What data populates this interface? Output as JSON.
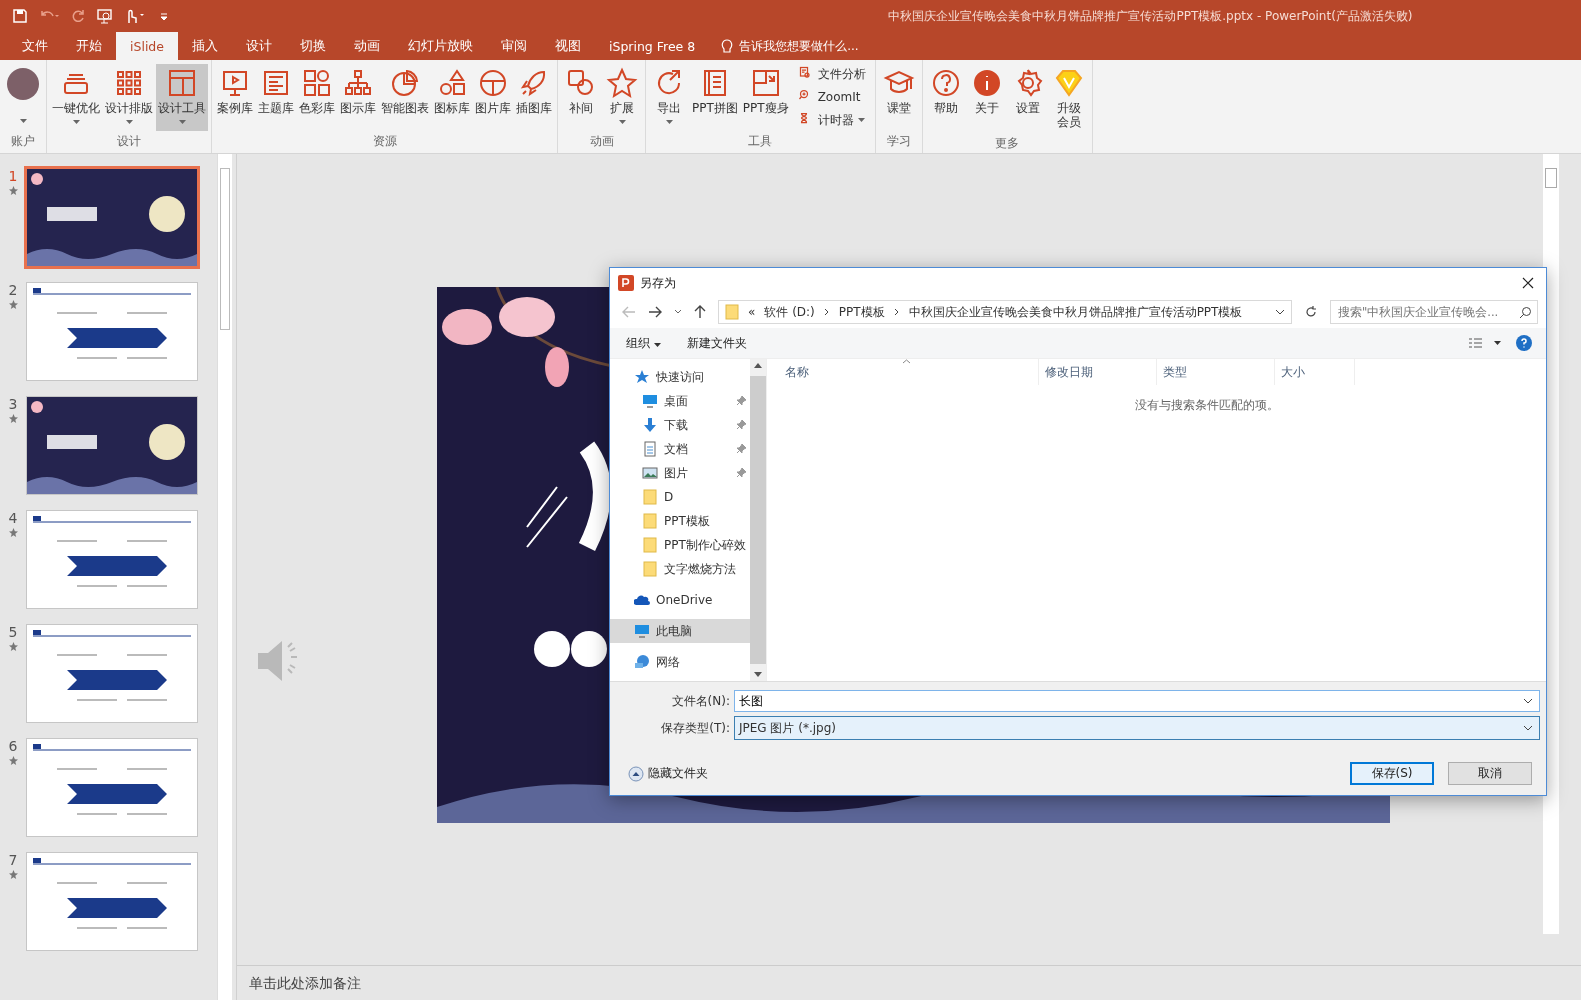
{
  "window": {
    "title": "中秋国庆企业宣传晚会美食中秋月饼品牌推广宣传活动PPT模板.pptx - PowerPoint(产品激活失败)"
  },
  "tabs": [
    {
      "label": "文件",
      "selected": false
    },
    {
      "label": "开始",
      "selected": false
    },
    {
      "label": "iSlide",
      "selected": true
    },
    {
      "label": "插入",
      "selected": false
    },
    {
      "label": "设计",
      "selected": false
    },
    {
      "label": "切换",
      "selected": false
    },
    {
      "label": "动画",
      "selected": false
    },
    {
      "label": "幻灯片放映",
      "selected": false
    },
    {
      "label": "审阅",
      "selected": false
    },
    {
      "label": "视图",
      "selected": false
    },
    {
      "label": "iSpring Free 8",
      "selected": false
    }
  ],
  "tell_me": {
    "placeholder": "告诉我您想要做什么..."
  },
  "ribbon": {
    "groups": [
      {
        "label": "账户",
        "items": [
          {
            "kind": "avatar",
            "dropdown": true
          }
        ]
      },
      {
        "label": "设计",
        "items": [
          {
            "kind": "large",
            "label": "一键优化",
            "dropdown": true,
            "selected": false
          },
          {
            "kind": "large",
            "label": "设计排版",
            "dropdown": true,
            "selected": false
          },
          {
            "kind": "large",
            "label": "设计工具",
            "dropdown": true,
            "selected": true
          }
        ]
      },
      {
        "label": "资源",
        "items": [
          {
            "kind": "large",
            "label": "案例库",
            "dropdown": false,
            "selected": false
          },
          {
            "kind": "large",
            "label": "主题库",
            "dropdown": false,
            "selected": false
          },
          {
            "kind": "large",
            "label": "色彩库",
            "dropdown": false,
            "selected": false
          },
          {
            "kind": "large",
            "label": "图示库",
            "dropdown": false,
            "selected": false
          },
          {
            "kind": "large",
            "label": "智能图表",
            "dropdown": false,
            "selected": false
          },
          {
            "kind": "large",
            "label": "图标库",
            "dropdown": false,
            "selected": false
          },
          {
            "kind": "large",
            "label": "图片库",
            "dropdown": false,
            "selected": false
          },
          {
            "kind": "large",
            "label": "插图库",
            "dropdown": false,
            "selected": false
          }
        ]
      },
      {
        "label": "动画",
        "items": [
          {
            "kind": "large",
            "label": "补间",
            "dropdown": false,
            "selected": false
          },
          {
            "kind": "large",
            "label": "扩展",
            "dropdown": true,
            "selected": false
          }
        ]
      },
      {
        "label": "工具",
        "items": [
          {
            "kind": "large",
            "label": "导出",
            "dropdown": true,
            "selected": false
          },
          {
            "kind": "large",
            "label": "PPT拼图",
            "dropdown": false,
            "selected": false
          },
          {
            "kind": "large",
            "label": "PPT瘦身",
            "dropdown": false,
            "selected": false
          },
          {
            "kind": "small",
            "label": "文件分析",
            "dropdown": false,
            "selected": false
          },
          {
            "kind": "small",
            "label": "ZoomIt",
            "dropdown": false,
            "selected": false
          },
          {
            "kind": "small",
            "label": "计时器",
            "dropdown": true,
            "selected": false
          }
        ]
      },
      {
        "label": "学习",
        "items": [
          {
            "kind": "large",
            "label": "课堂",
            "dropdown": false,
            "selected": false
          }
        ]
      },
      {
        "label": "更多",
        "items": [
          {
            "kind": "large",
            "label": "帮助",
            "dropdown": false,
            "selected": false
          },
          {
            "kind": "large",
            "label": "关于",
            "dropdown": false,
            "selected": false
          },
          {
            "kind": "large",
            "label": "设置",
            "dropdown": false,
            "selected": false
          },
          {
            "kind": "tall",
            "label": "升级会员",
            "dropdown": false,
            "selected": false
          }
        ]
      }
    ]
  },
  "slides": [
    {
      "number": "1",
      "selected": true,
      "kind": "dark"
    },
    {
      "number": "2",
      "selected": false,
      "kind": "light"
    },
    {
      "number": "3",
      "selected": false,
      "kind": "dark"
    },
    {
      "number": "4",
      "selected": false,
      "kind": "light"
    },
    {
      "number": "5",
      "selected": false,
      "kind": "light"
    },
    {
      "number": "6",
      "selected": false,
      "kind": "light"
    },
    {
      "number": "7",
      "selected": false,
      "kind": "light"
    }
  ],
  "notes": {
    "placeholder": "单击此处添加备注"
  },
  "dialog": {
    "title": "另存为",
    "address": {
      "prefix": "«",
      "crumbs": [
        "软件 (D:)",
        "PPT模板",
        "中秋国庆企业宣传晚会美食中秋月饼品牌推广宣传活动PPT模板"
      ]
    },
    "search": {
      "placeholder": "搜索\"中秋国庆企业宣传晚会..."
    },
    "toolbar": {
      "organize": "组织",
      "new_folder": "新建文件夹"
    },
    "nav": [
      {
        "label": "快速访问",
        "kind": "quick",
        "pinned": false,
        "selected": false,
        "children": [
          {
            "label": "桌面",
            "kind": "desktop",
            "pinned": true,
            "selected": false
          },
          {
            "label": "下载",
            "kind": "download",
            "pinned": true,
            "selected": false
          },
          {
            "label": "文档",
            "kind": "docs",
            "pinned": true,
            "selected": false
          },
          {
            "label": "图片",
            "kind": "pictures",
            "pinned": true,
            "selected": false
          },
          {
            "label": "D",
            "kind": "folder",
            "pinned": false,
            "selected": false
          },
          {
            "label": "PPT模板",
            "kind": "folder",
            "pinned": false,
            "selected": false
          },
          {
            "label": "PPT制作心碎效",
            "kind": "folder",
            "pinned": false,
            "selected": false
          },
          {
            "label": "文字燃烧方法",
            "kind": "folder",
            "pinned": false,
            "selected": false
          }
        ]
      },
      {
        "label": "OneDrive",
        "kind": "onedrive",
        "pinned": false,
        "selected": false
      },
      {
        "label": "此电脑",
        "kind": "pc",
        "pinned": false,
        "selected": true
      },
      {
        "label": "网络",
        "kind": "network",
        "pinned": false,
        "selected": false
      }
    ],
    "columns": [
      "名称",
      "修改日期",
      "类型",
      "大小"
    ],
    "empty_message": "没有与搜索条件匹配的项。",
    "file_name": {
      "label": "文件名(N):",
      "value": "长图"
    },
    "file_type": {
      "label": "保存类型(T):",
      "value": "JPEG 图片 (*.jpg)"
    },
    "hide_folders": "隐藏文件夹",
    "buttons": [
      {
        "label": "保存(S)",
        "primary": true
      },
      {
        "label": "取消",
        "primary": false
      }
    ]
  }
}
